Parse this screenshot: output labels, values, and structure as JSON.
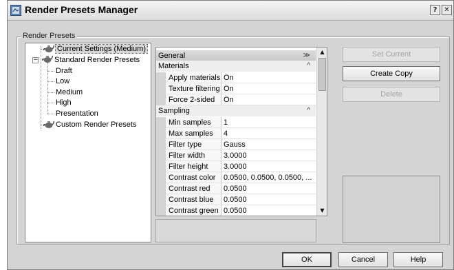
{
  "window": {
    "title": "Render Presets Manager",
    "help_button": "?",
    "close_button": "✕"
  },
  "group": {
    "legend": "Render Presets"
  },
  "tree": {
    "items": [
      {
        "label": "Current Settings (Medium)"
      },
      {
        "label": "Standard Render Presets",
        "expander": "−"
      },
      {
        "label": "Draft"
      },
      {
        "label": "Low"
      },
      {
        "label": "Medium"
      },
      {
        "label": "High"
      },
      {
        "label": "Presentation"
      },
      {
        "label": "Custom Render Presets"
      }
    ]
  },
  "properties": {
    "general": {
      "label": "General",
      "arrow": "≫"
    },
    "categories": [
      {
        "label": "Materials",
        "arrow": "^",
        "rows": [
          {
            "name": "Apply materials",
            "value": "On"
          },
          {
            "name": "Texture filtering",
            "value": "On"
          },
          {
            "name": "Force 2-sided",
            "value": "On"
          }
        ]
      },
      {
        "label": "Sampling",
        "arrow": "^",
        "rows": [
          {
            "name": "Min samples",
            "value": "1"
          },
          {
            "name": "Max samples",
            "value": "4"
          },
          {
            "name": "Filter type",
            "value": "Gauss"
          },
          {
            "name": "Filter width",
            "value": "3.0000"
          },
          {
            "name": "Filter height",
            "value": "3.0000"
          },
          {
            "name": "Contrast color",
            "value": "0.0500, 0.0500, 0.0500, ..."
          },
          {
            "name": "Contrast red",
            "value": "0.0500"
          },
          {
            "name": "Contrast blue",
            "value": "0.0500"
          },
          {
            "name": "Contrast green",
            "value": "0.0500"
          }
        ]
      }
    ],
    "scroll_up": "▲",
    "scroll_down": "▼"
  },
  "buttons": {
    "set_current": "Set Current",
    "create_copy": "Create Copy",
    "delete": "Delete",
    "ok": "OK",
    "cancel": "Cancel",
    "help": "Help"
  },
  "colors": {
    "dialog_bg": "#d4d4d4",
    "panel_bg": "#ffffff",
    "category_bg": "#c8c8c8"
  },
  "icons": {
    "title": "app-icon",
    "tree_item": "teapot-icon"
  }
}
